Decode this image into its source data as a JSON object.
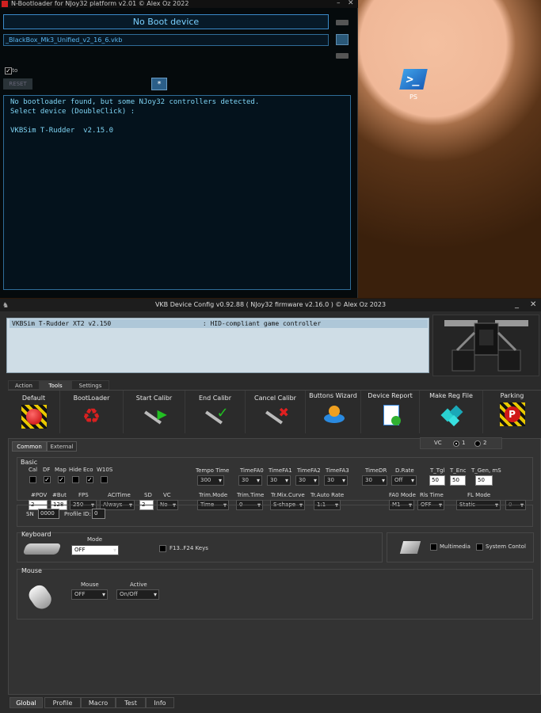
{
  "bootloader": {
    "title": "N-Bootloader for NJoy32 platform v2.01 © Alex Oz 2022",
    "device_status": "No Boot device",
    "file": "_BlackBox_Mk3_Unified_v2_16_6.vkb",
    "auto_label": "Auto",
    "auto_checked": true,
    "reset_label": "RESET",
    "star_label": "*",
    "log_lines": [
      "No bootloader found, but some NJoy32 controllers detected.",
      "Select device (DoubleClick) :",
      "",
      "VKBSim T-Rudder  v2.15.0"
    ]
  },
  "desktop": {
    "shortcut_label": "PS"
  },
  "vkb": {
    "title": "VKB Device Config v0.92.88 ( NJoy32 firmware v2.16.0 ) © Alex Oz 2023",
    "device_row": "VKBSim T-Rudder XT2 v2.150                        : HID-compliant game controller",
    "main_tabs": [
      "Action",
      "Tools",
      "Settings"
    ],
    "tools": [
      "Default",
      "BootLoader",
      "Start Calibr",
      "End Calibr",
      "Cancel Calibr",
      "Buttons Wizard",
      "Device Report",
      "Make Reg File",
      "Parking"
    ],
    "sub_tabs": [
      "Common",
      "External"
    ],
    "vc": {
      "label": "VC",
      "opt1": "1",
      "opt2": "2"
    },
    "basic": {
      "title": "Basic",
      "check_labels": [
        "Cal",
        "DF",
        "Map",
        "Hide",
        "Eco",
        "W10S"
      ],
      "checks": [
        false,
        true,
        true,
        false,
        true,
        false
      ],
      "pov_label": "#POV",
      "pov": "2",
      "but_label": "#But",
      "but": "128",
      "fps_label": "FPS",
      "fps": "250",
      "acitime_label": "ACITime",
      "acitime": "Always",
      "sd_label": "SD",
      "sd": "2",
      "vc_label": "VC",
      "vc": "No",
      "tempo_label": "Tempo Time",
      "tempo": "300",
      "tfa0_label": "TimeFA0",
      "tfa0": "30",
      "tfa1_label": "TimeFA1",
      "tfa1": "30",
      "tfa2_label": "TimeFA2",
      "tfa2": "30",
      "tfa3_label": "TimeFA3",
      "tfa3": "30",
      "trimmode_label": "Trim.Mode",
      "trimmode": "Time",
      "trimtime_label": "Trim.Time",
      "trimtime": "0",
      "mixcurve_label": "Tr.Mix.Curve",
      "mixcurve": "S-shape",
      "autorate_label": "Tr.Auto Rate",
      "autorate": "1:1",
      "timedr_label": "TimeDR",
      "timedr": "30",
      "drate_label": "D.Rate",
      "drate": "Off",
      "ttgl_label": "T_Tgl",
      "ttgl": "50",
      "tenc_label": "T_Enc",
      "tenc": "50",
      "tgen_label": "T_Gen, mS",
      "tgen": "50",
      "fa0mode_label": "FA0 Mode",
      "fa0mode": "M1",
      "rlstime_label": "Rls Time",
      "rlstime": "OFF",
      "flmode_label": "FL Mode",
      "flmode": "Static",
      "flval": "0"
    },
    "sn_label": "SN",
    "sn": "0000",
    "profile_label": "Profile ID:",
    "profile": "0",
    "keyboard": {
      "title": "Keyboard",
      "mode_label": "Mode",
      "mode": "OFF",
      "f13_label": "F13..F24 Keys",
      "multimedia_label": "Multimedia",
      "system_label": "System Contol"
    },
    "mouse": {
      "title": "Mouse",
      "mouse_label": "Mouse",
      "mouse": "OFF",
      "active_label": "Active",
      "active": "On/Off"
    },
    "bottom_tabs": [
      "Global",
      "Profile",
      "Macro",
      "Test",
      "Info"
    ]
  }
}
